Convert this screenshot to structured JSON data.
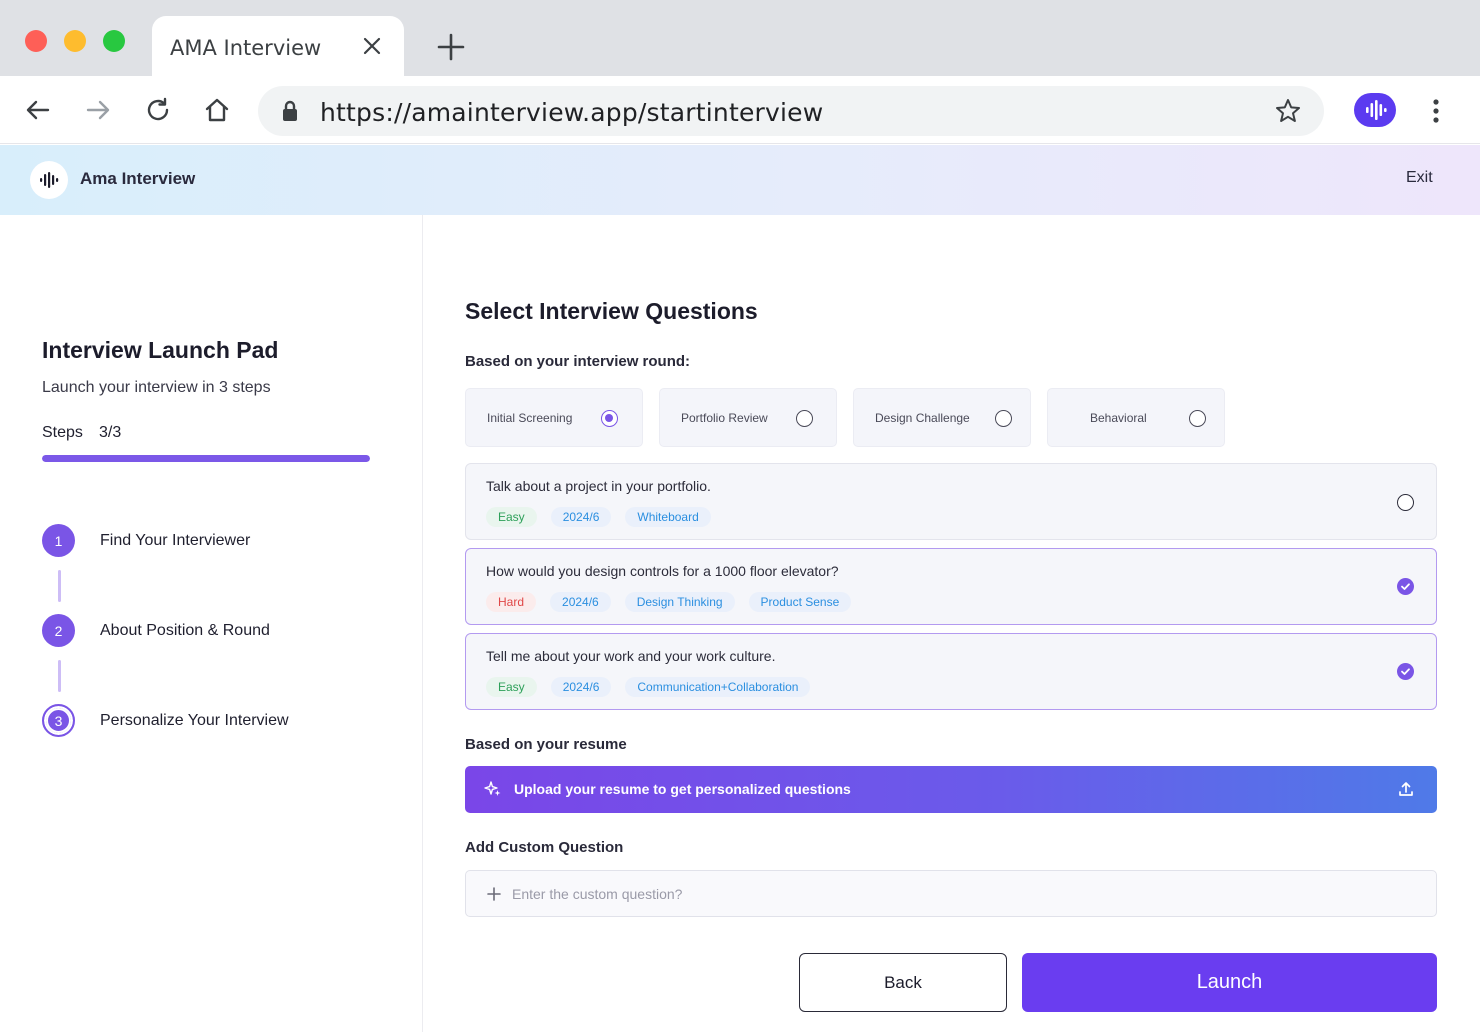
{
  "browser": {
    "tab_title": "AMA Interview",
    "url": "https://amainterview.app/startinterview"
  },
  "header": {
    "brand": "Ama Interview",
    "exit_label": "Exit"
  },
  "sidebar": {
    "title": "Interview Launch Pad",
    "subtitle": "Launch your interview in 3 steps",
    "steps_label": "Steps",
    "steps_count": "3/3",
    "progress_fraction": 1.0,
    "steps": [
      {
        "number": "1",
        "label": "Find Your Interviewer"
      },
      {
        "number": "2",
        "label": "About Position & Round"
      },
      {
        "number": "3",
        "label": "Personalize Your Interview"
      }
    ]
  },
  "main": {
    "title": "Select Interview Questions",
    "round_label": "Based on your interview round:",
    "rounds": [
      {
        "label": "Initial Screening",
        "selected": true
      },
      {
        "label": "Portfolio Review",
        "selected": false
      },
      {
        "label": "Design Challenge",
        "selected": false
      },
      {
        "label": "Behavioral",
        "selected": false
      }
    ],
    "questions": [
      {
        "text": "Talk about a project in your portfolio.",
        "difficulty": "Easy",
        "tags": [
          "2024/6",
          "Whiteboard"
        ],
        "selected": false
      },
      {
        "text": "How would you design controls for a 1000 floor elevator?",
        "difficulty": "Hard",
        "tags": [
          "2024/6",
          "Design Thinking",
          "Product Sense"
        ],
        "selected": true
      },
      {
        "text": "Tell me about your work and your work culture.",
        "difficulty": "Easy",
        "tags": [
          "2024/6",
          "Communication+Collaboration"
        ],
        "selected": true
      }
    ],
    "resume_label": "Based on your resume",
    "upload_label": "Upload your resume to get personalized questions",
    "custom_label": "Add Custom Question",
    "custom_placeholder": "Enter the custom question?",
    "custom_value": "",
    "back_label": "Back",
    "launch_label": "Launch"
  },
  "colors": {
    "accent": "#7a55e6",
    "launch": "#6a3df0",
    "easy": "#2ea05a",
    "hard": "#e04848",
    "tag": "#2b8fe0"
  }
}
